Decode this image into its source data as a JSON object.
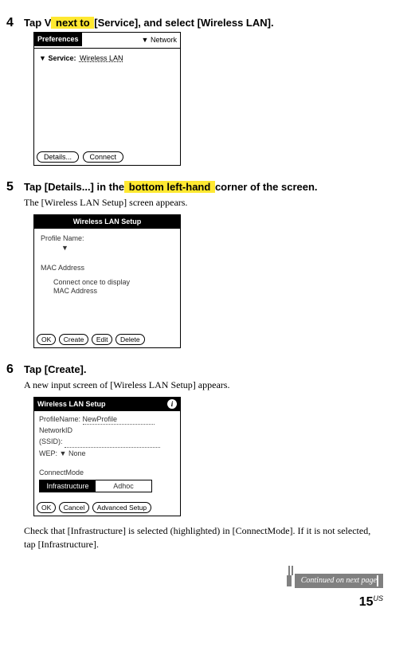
{
  "step4": {
    "num": "4",
    "title_pre": "Tap V",
    "title_hl": " next to ",
    "title_post": "[Service], and select [Wireless LAN].",
    "screen": {
      "title": "Preferences",
      "topright": "Network",
      "service_label": "Service:",
      "service_value": "Wireless LAN",
      "btn_details": "Details...",
      "btn_connect": "Connect"
    }
  },
  "step5": {
    "num": "5",
    "title_pre": "Tap [Details...] in the",
    "title_hl": " bottom left-hand ",
    "title_post": "corner of the screen.",
    "desc": "The [Wireless LAN Setup] screen appears.",
    "screen": {
      "title": "Wireless LAN Setup",
      "profile_label": "Profile Name:",
      "mac_label": "MAC Address",
      "mac_sub1": "Connect once to display",
      "mac_sub2": "MAC Address",
      "btn_ok": "OK",
      "btn_create": "Create",
      "btn_edit": "Edit",
      "btn_delete": "Delete"
    }
  },
  "step6": {
    "num": "6",
    "title": "Tap [Create].",
    "desc": "A new input screen of [Wireless LAN Setup] appears.",
    "screen": {
      "title": "Wireless LAN Setup",
      "profile_label": "ProfileName:",
      "profile_value": "NewProfile",
      "netid_label": "NetworkID",
      "ssid_label": "(SSID):",
      "wep_label": "WEP:",
      "wep_value": "None",
      "connect_label": "ConnectMode",
      "tab_infra": "Infrastructure",
      "tab_adhoc": "Adhoc",
      "btn_ok": "OK",
      "btn_cancel": "Cancel",
      "btn_adv": "Advanced Setup"
    },
    "check_text": "Check that [Infrastructure] is selected (highlighted) in [ConnectMode]. If it is not selected, tap [Infrastructure]."
  },
  "footer": {
    "continued": "Continued on next page",
    "page": "15",
    "region": "US"
  }
}
